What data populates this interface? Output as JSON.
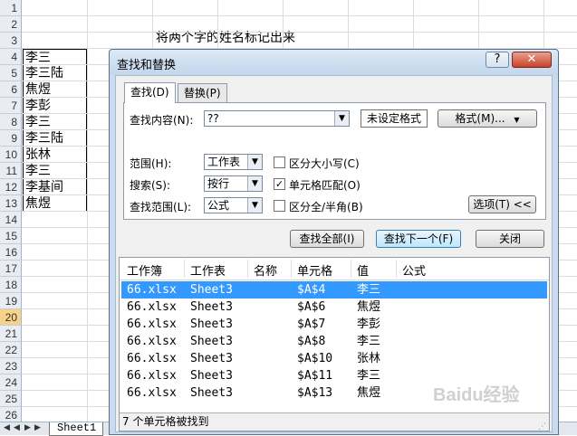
{
  "sheet": {
    "rows": [
      "1",
      "2",
      "3",
      "4",
      "5",
      "6",
      "7",
      "8",
      "9",
      "10",
      "11",
      "12",
      "13",
      "14",
      "15",
      "16",
      "17",
      "18",
      "19",
      "20",
      "21",
      "22",
      "23",
      "24",
      "25",
      "26"
    ],
    "selected_row": "20",
    "title_text": "将两个字的姓名标记出来",
    "names": [
      "李三",
      "李三陆",
      "焦煜",
      "李彭",
      "李三",
      "李三陆",
      "张林",
      "李三",
      "李基间",
      "焦煜"
    ],
    "tab_name": "Sheet1"
  },
  "dialog": {
    "title": "查找和替换",
    "help_label": "?",
    "close_label": "✕",
    "tabs": [
      "查找(D)",
      "替换(P)"
    ],
    "find_label": "查找内容(N):",
    "find_value": "??",
    "format_status": "未设定格式",
    "format_button": "格式(M)...",
    "within_label": "范围(H):",
    "within_value": "工作表",
    "search_label": "搜索(S):",
    "search_value": "按行",
    "lookin_label": "查找范围(L):",
    "lookin_value": "公式",
    "options": [
      {
        "label": "区分大小写(C)",
        "checked": false
      },
      {
        "label": "单元格匹配(O)",
        "checked": true
      },
      {
        "label": "区分全/半角(B)",
        "checked": false
      }
    ],
    "options_button": "选项(T) <<",
    "find_all_button": "查找全部(I)",
    "find_next_button": "查找下一个(F)",
    "close_button": "关闭",
    "results": {
      "columns": [
        "工作簿",
        "工作表",
        "名称",
        "单元格",
        "值",
        "公式"
      ],
      "rows": [
        {
          "book": "66.xlsx",
          "sheet": "Sheet3",
          "name": "",
          "cell": "$A$4",
          "value": "李三",
          "formula": ""
        },
        {
          "book": "66.xlsx",
          "sheet": "Sheet3",
          "name": "",
          "cell": "$A$6",
          "value": "焦煜",
          "formula": ""
        },
        {
          "book": "66.xlsx",
          "sheet": "Sheet3",
          "name": "",
          "cell": "$A$7",
          "value": "李彭",
          "formula": ""
        },
        {
          "book": "66.xlsx",
          "sheet": "Sheet3",
          "name": "",
          "cell": "$A$8",
          "value": "李三",
          "formula": ""
        },
        {
          "book": "66.xlsx",
          "sheet": "Sheet3",
          "name": "",
          "cell": "$A$10",
          "value": "张林",
          "formula": ""
        },
        {
          "book": "66.xlsx",
          "sheet": "Sheet3",
          "name": "",
          "cell": "$A$11",
          "value": "李三",
          "formula": ""
        },
        {
          "book": "66.xlsx",
          "sheet": "Sheet3",
          "name": "",
          "cell": "$A$13",
          "value": "焦煜",
          "formula": ""
        }
      ],
      "status": "7 个单元格被找到"
    }
  },
  "watermark": "Baidu经验",
  "colors": {
    "selection": "#3399ff",
    "row_header_selected": "#f7d28a",
    "close_red": "#c8412b"
  }
}
